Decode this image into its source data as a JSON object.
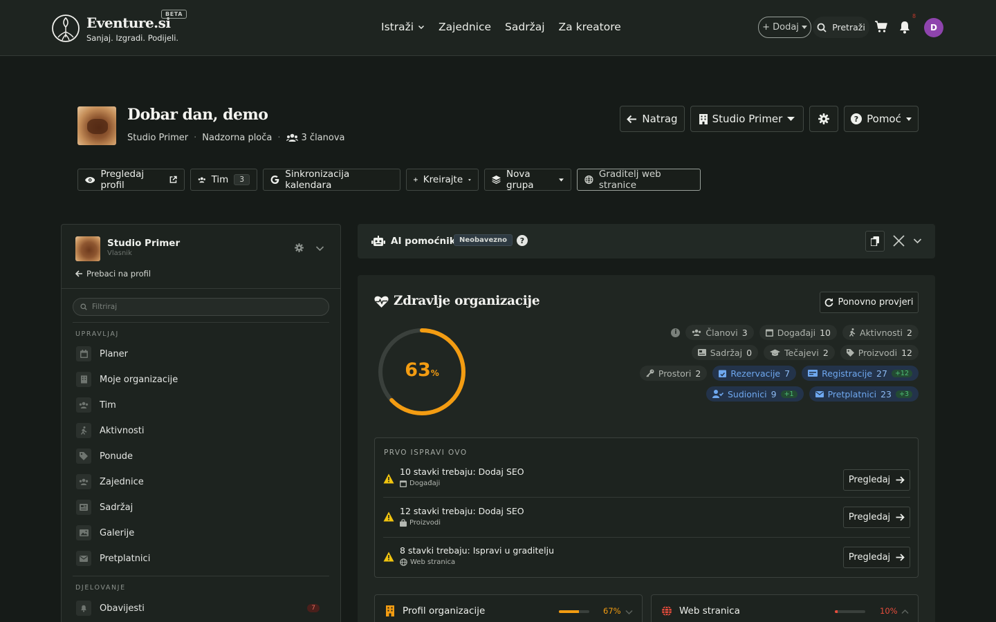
{
  "brand": {
    "title": "Eventure.si",
    "beta": "BETA",
    "tagline": "Sanjaj. Izgradi. Podijeli."
  },
  "nav": {
    "links": [
      "Istraži",
      "Zajednice",
      "Sadržaj",
      "Za kreatore"
    ],
    "add_label": "+ Dodaj",
    "search_label": "Pretraži",
    "notif_count": "8",
    "avatar_initial": "D"
  },
  "header": {
    "greeting": "Dobar dan, demo",
    "org": "Studio Primer",
    "page": "Nadzorna ploča",
    "members": "3 članova",
    "back": "Natrag",
    "org_select": "Studio Primer",
    "help": "Pomoć"
  },
  "actions": {
    "view_profile": "Pregledaj profil",
    "team": "Tim",
    "team_count": "3",
    "calendar_sync": "Sinkronizacija kalendara",
    "create": "Kreirajte",
    "new_group": "Nova grupa",
    "site_builder": "Graditelj web stranice"
  },
  "sidebar": {
    "org_name": "Studio Primer",
    "role": "Vlasnik",
    "switch_label": "Prebaci na profil",
    "filter_placeholder": "Filtriraj",
    "section_manage": "UPRAVLJAJ",
    "items": [
      {
        "label": "Planer",
        "icon": "calendar-icon"
      },
      {
        "label": "Moje organizacije",
        "icon": "building-icon"
      },
      {
        "label": "Tim",
        "icon": "users-icon"
      },
      {
        "label": "Aktivnosti",
        "icon": "running-icon"
      },
      {
        "label": "Ponude",
        "icon": "tag-icon"
      },
      {
        "label": "Zajednice",
        "icon": "community-icon"
      },
      {
        "label": "Sadržaj",
        "icon": "newspaper-icon"
      },
      {
        "label": "Galerije",
        "icon": "images-icon"
      },
      {
        "label": "Pretplatnici",
        "icon": "envelope-icon"
      }
    ],
    "section_ops": "DJELOVANJE",
    "ops_items": [
      {
        "label": "Obavijesti",
        "icon": "bell-icon",
        "badge": "7"
      }
    ]
  },
  "ai": {
    "label": "AI pomoćnik",
    "chip": "Neobavezno",
    "help": "?"
  },
  "health": {
    "title": "Zdravlje organizacije",
    "recheck": "Ponovno provjeri",
    "score": 63,
    "score_text": "63",
    "score_unit": "%",
    "accent": "#f39c12",
    "stats": [
      [
        {
          "label": "Članovi",
          "value": "3",
          "icon": "users-icon"
        },
        {
          "label": "Događaji",
          "value": "10",
          "icon": "calendar-icon"
        },
        {
          "label": "Aktivnosti",
          "value": "2",
          "icon": "running-icon"
        }
      ],
      [
        {
          "label": "Sadržaj",
          "value": "0",
          "icon": "newspaper-icon"
        },
        {
          "label": "Tečajevi",
          "value": "2",
          "icon": "graduation-cap-icon"
        },
        {
          "label": "Proizvodi",
          "value": "12",
          "icon": "tag-icon"
        }
      ],
      [
        {
          "label": "Prostori",
          "value": "2",
          "icon": "key-icon"
        },
        {
          "label": "Rezervacije",
          "value": "7",
          "icon": "calendar-check-icon",
          "hi": true
        },
        {
          "label": "Registracije",
          "value": "27",
          "delta": "+12",
          "icon": "id-card-icon",
          "hi": true
        }
      ],
      [
        {
          "label": "Sudionici",
          "value": "9",
          "delta": "+1",
          "icon": "user-check-icon",
          "hi": true
        },
        {
          "label": "Pretplatnici",
          "value": "23",
          "delta": "+3",
          "icon": "envelope-icon",
          "hi": true
        }
      ]
    ],
    "fix_heading": "PRVO ISPRAVI OVO",
    "fixes": [
      {
        "title": "10 stavki trebaju: Dodaj SEO",
        "sub": "Događaji",
        "icon": "calendar-icon",
        "button": "Pregledaj"
      },
      {
        "title": "12 stavki trebaju: Dodaj SEO",
        "sub": "Proizvodi",
        "icon": "bag-icon",
        "button": "Pregledaj"
      },
      {
        "title": "8 stavki trebaju: Ispravi u graditelju",
        "sub": "Web stranica",
        "icon": "globe-icon",
        "button": "Pregledaj"
      }
    ],
    "cards": [
      {
        "title": "Profil organizacije",
        "pct": 67,
        "pct_text": "67%",
        "color": "#f39c12"
      },
      {
        "title": "Web stranica",
        "pct": 10,
        "pct_text": "10%",
        "color": "#e74c3c"
      }
    ]
  }
}
